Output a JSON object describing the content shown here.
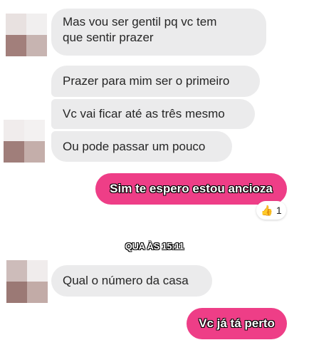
{
  "conversation": {
    "incoming_1": {
      "lines": [
        "Mas vou ser gentil pq vc tem",
        "que sentir prazer"
      ]
    },
    "incoming_2": "Prazer para mim ser o primeiro",
    "incoming_3": "Vc vai ficar até as três mesmo",
    "incoming_4": "Ou pode passar um pouco",
    "outgoing_1": "Sim te espero estou ancioza",
    "reaction": {
      "icon": "thumbs-up-icon",
      "emoji": "👍",
      "count": "1"
    },
    "timestamp": "QUA ÀS 15:11",
    "incoming_5": "Qual o número da casa",
    "outgoing_2": "Vc já tá perto"
  },
  "colors": {
    "incoming_bubble": "#ebebec",
    "outgoing_bubble": "#ee3e87",
    "text": "#262626"
  }
}
